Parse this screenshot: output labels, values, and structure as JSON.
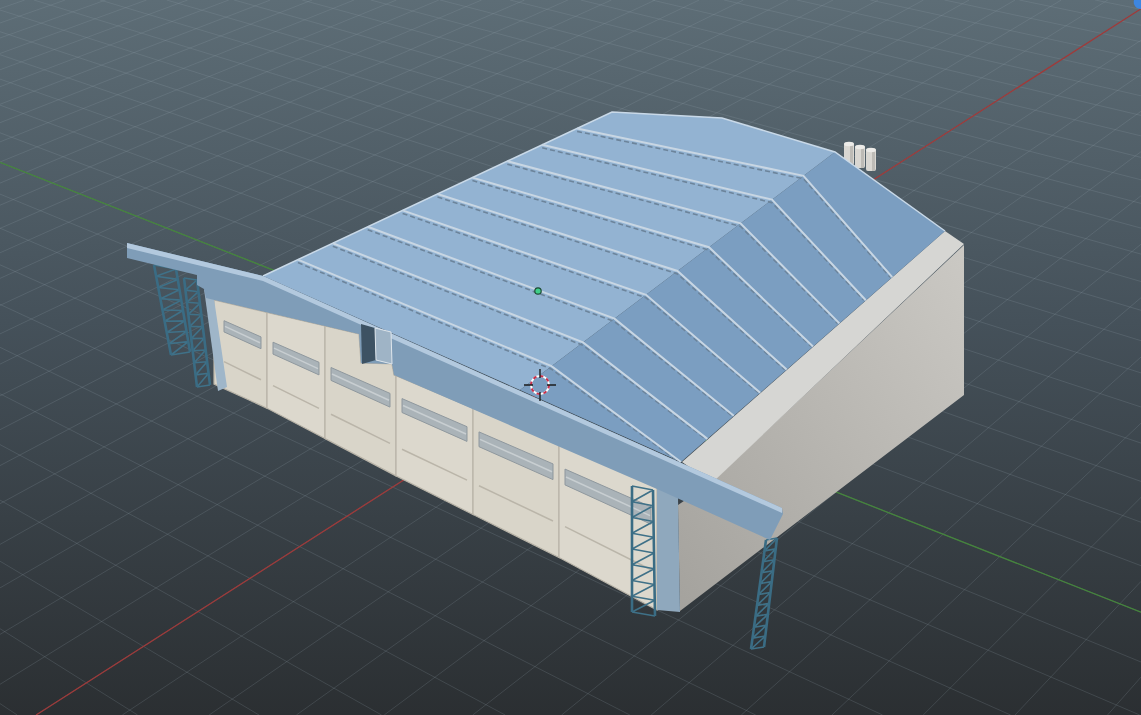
{
  "viewport": {
    "axes": [
      {
        "color": "#9e3a3a"
      },
      {
        "color": "#45853c"
      }
    ]
  }
}
